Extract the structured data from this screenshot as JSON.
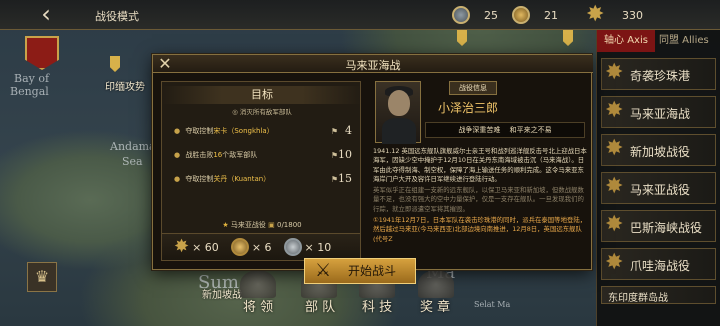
{
  "topbar": {
    "back_icon": "chevron-left-icon",
    "title": "战役模式",
    "resources": [
      {
        "icon": "silver-medal-icon",
        "value": "25"
      },
      {
        "icon": "gold-medal-icon",
        "value": "21"
      },
      {
        "icon": "star-medal-icon",
        "value": "330"
      }
    ]
  },
  "map": {
    "labels": [
      "Bay of",
      "Bengal",
      "Andaman",
      "Sea",
      "Sum",
      "Ma",
      "Selat Ma"
    ],
    "places": [
      "印缅攻势",
      "新加坡战"
    ]
  },
  "right_panel": {
    "tab_axis": "轴心 Axis",
    "tab_allies": "同盟 Allies",
    "battles": [
      "奇袭珍珠港",
      "马来亚海战",
      "新加坡战役",
      "马来亚战役",
      "巴斯海峡战役",
      "爪哇海战役"
    ],
    "partial_item": "东印度群岛战"
  },
  "bottom_menu": [
    "将 领",
    "部 队",
    "科 技",
    "奖 章"
  ],
  "modal": {
    "title": "马来亚海战",
    "close_icon": "close-icon",
    "objectives": {
      "title": "目标",
      "subtitle": "◎ 消灭所有敌军部队",
      "items": [
        {
          "text_pre": "夺取控制",
          "highlight": "宋卡（Songkhla）",
          "text_post": "",
          "count": "4"
        },
        {
          "text_pre": "战胜击败",
          "highlight": "16",
          "text_post": "个敌军部队",
          "count": "10"
        },
        {
          "text_pre": "夺取控制",
          "highlight": "关丹（Kuantan）",
          "text_post": "",
          "count": "15"
        }
      ],
      "progress_label": "马来亚战役",
      "progress_value": "0/1800"
    },
    "rewards": [
      {
        "icon": "star-medal-icon",
        "value": "× 60"
      },
      {
        "icon": "gold-medal-icon",
        "value": "× 6"
      },
      {
        "icon": "silver-medal-icon",
        "value": "× 10"
      }
    ],
    "commander": {
      "info_tag": "战役信息",
      "name": "小泽治三郎",
      "traits": "战争深重苦难　 和平来之不易"
    },
    "description": {
      "para1": "1941.12 英国远东舰队旗舰威尔士亲王号和战列巡洋舰反击号北上迎战日本海军，因缺少空中掩护于12月10日在关丹东南海域被击沉（马来海战）。日军由此夺得制海、制空权，保障了海上输送任务的顺利完成。这令马来亚东海岸门户大开及容许日军继续进行登陆行动。",
      "para2": "英军似乎正在组建一支新的远东舰队，以保卫马来亚和新加坡，但数战舰数量不足，也没有强大的空中力量保护，仅是一支存在舰队。一旦发现我们的行踪，就立即派遣空军将其摧毁。",
      "para3": "①1941年12月7日，日本军队在袭击珍珠港的同时，派兵在泰国等地登陆，然后越过马来亚(今马来西亚)北部边境向南推进，12月8日，英国远东舰队(代号Z"
    },
    "start_button": {
      "icon": "crossed-swords-icon",
      "label": "开始战斗"
    }
  }
}
